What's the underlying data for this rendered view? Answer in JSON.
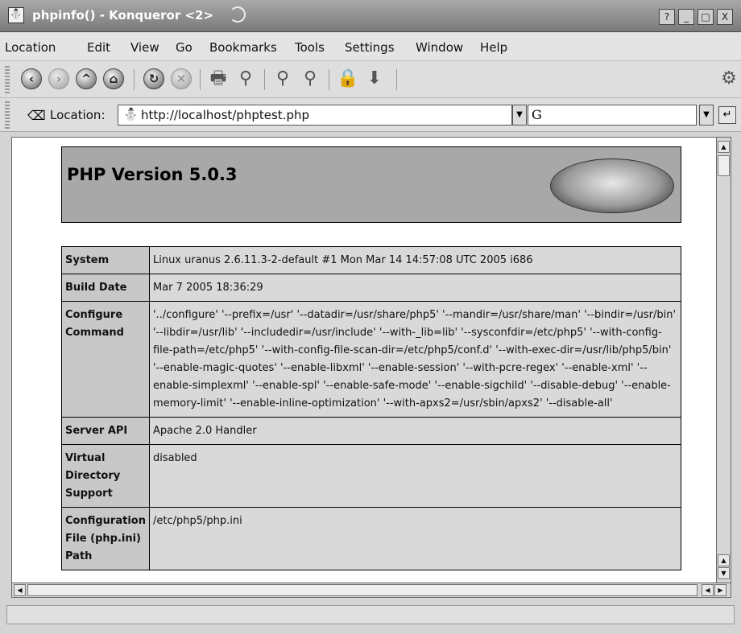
{
  "window": {
    "title": "phpinfo() - Konqueror <2>",
    "buttons": [
      "?",
      "_",
      "□",
      "X"
    ]
  },
  "menubar": {
    "items": [
      "Location",
      "Edit",
      "View",
      "Go",
      "Bookmarks",
      "Tools",
      "Settings",
      "Window",
      "Help"
    ]
  },
  "toolbar": {
    "icons": [
      "back-icon",
      "forward-icon",
      "up-icon",
      "home-icon",
      "reload-icon",
      "stop-icon",
      "print-icon",
      "find-icon",
      "zoom-in-icon",
      "zoom-out-icon",
      "security-lock-icon",
      "download-icon",
      "settings-gear-icon"
    ]
  },
  "location": {
    "label": "Location:",
    "url": "http://localhost/phptest.php",
    "search_value": "G"
  },
  "page": {
    "header": {
      "title": "PHP Version 5.0.3"
    },
    "rows": [
      {
        "key": "System",
        "value": "Linux uranus 2.6.11.3-2-default #1 Mon Mar 14 14:57:08 UTC 2005 i686"
      },
      {
        "key": "Build Date",
        "value": "Mar 7 2005 18:36:29"
      },
      {
        "key": "Configure Command",
        "value": "'../configure' '--prefix=/usr' '--datadir=/usr/share/php5' '--mandir=/usr/share/man' '--bindir=/usr/bin' '--libdir=/usr/lib' '--includedir=/usr/include' '--with-_lib=lib' '--sysconfdir=/etc/php5' '--with-config-file-path=/etc/php5' '--with-config-file-scan-dir=/etc/php5/conf.d' '--with-exec-dir=/usr/lib/php5/bin' '--enable-magic-quotes' '--enable-libxml' '--enable-session' '--with-pcre-regex' '--enable-xml' '--enable-simplexml' '--enable-spl' '--enable-safe-mode' '--enable-sigchild' '--disable-debug' '--enable-memory-limit' '--enable-inline-optimization' '--with-apxs2=/usr/sbin/apxs2' '--disable-all'"
      },
      {
        "key": "Server API",
        "value": "Apache 2.0 Handler"
      },
      {
        "key": "Virtual Directory Support",
        "value": "disabled"
      },
      {
        "key": "Configuration File (php.ini) Path",
        "value": "/etc/php5/php.ini"
      }
    ]
  }
}
